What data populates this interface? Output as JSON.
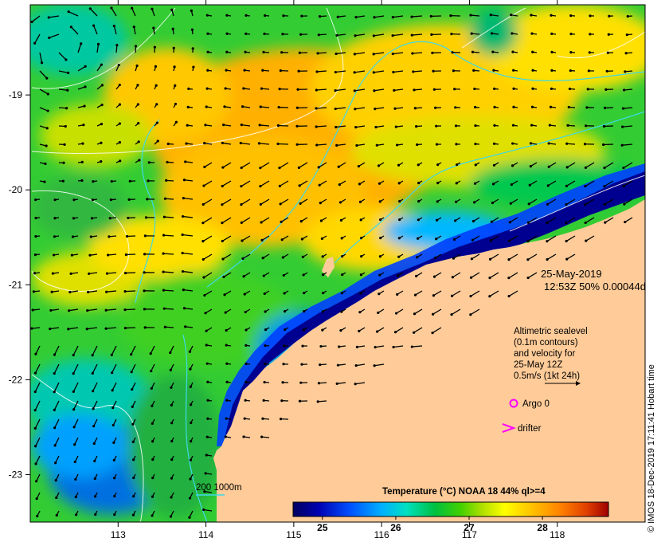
{
  "map": {
    "x_axis": {
      "ticks": [
        "113",
        "114",
        "115",
        "116",
        "117",
        "118"
      ],
      "range": [
        112.0,
        119.0
      ]
    },
    "y_axis": {
      "ticks": [
        "-19",
        "-20",
        "-21",
        "-22",
        "-23"
      ],
      "range": [
        -23.5,
        -18.05
      ]
    }
  },
  "annotation": {
    "date": "25-May-2019",
    "time_line": "12:53Z  50% 0.00044d"
  },
  "altimetry": {
    "lines": [
      "Altimetric sealevel",
      "(0.1m contours)",
      "and velocity for",
      "25-May 12Z",
      "0.5m/s (1kt 24h)"
    ]
  },
  "legend": {
    "argo": "Argo 0",
    "drifter": "drifter",
    "contours": "200  1000m",
    "argo_color": "#ff00ff",
    "drifter_color": "#ff00ff",
    "contour_color": "#40d8e8"
  },
  "colorbar": {
    "title": "Temperature (°C) NOAA 18 44% ql>=4",
    "ticks": [
      "25",
      "26",
      "27",
      "28"
    ],
    "tick_values": [
      25,
      26,
      27,
      28
    ],
    "range": [
      24.6,
      28.9
    ],
    "colors": [
      "#000060",
      "#0000b0",
      "#0050ff",
      "#00b0ff",
      "#00e0c0",
      "#00c040",
      "#40d000",
      "#b0e000",
      "#ffff00",
      "#ffc000",
      "#ff8000",
      "#e04000",
      "#a00000"
    ]
  },
  "credit": "© IMOS 18-Dec-2019 17:11:41 Hobart time",
  "land_color": "#ffcc99"
}
